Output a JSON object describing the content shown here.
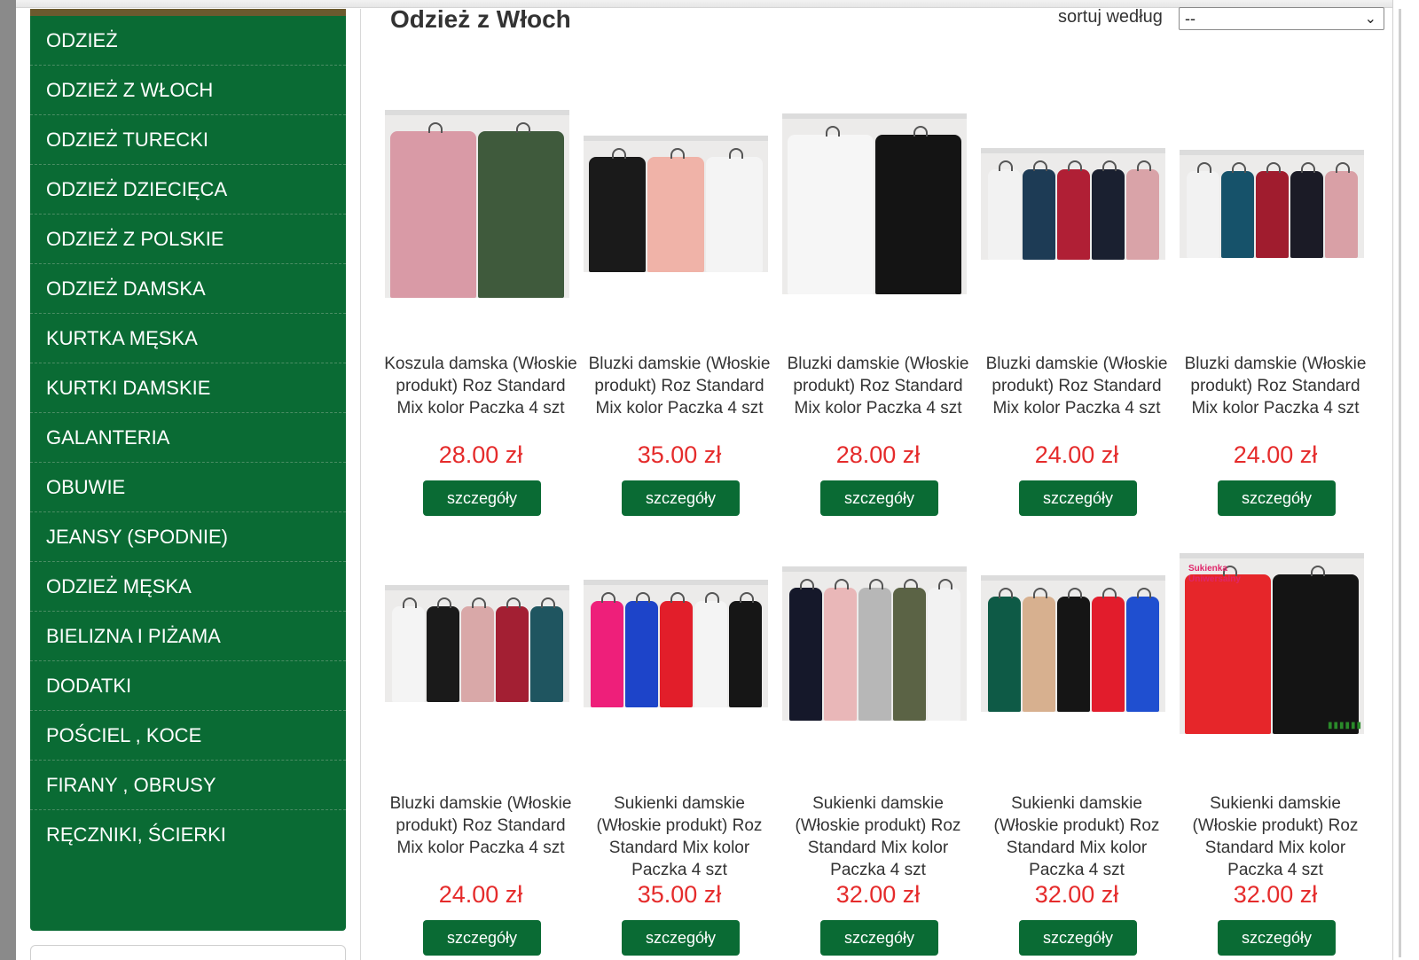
{
  "sidebar": {
    "items": [
      {
        "label": "ODZIEŻ"
      },
      {
        "label": "ODZIEŻ Z WŁOCH"
      },
      {
        "label": "ODZIEŻ TURECKI"
      },
      {
        "label": "ODZIEŻ DZIECIĘCA"
      },
      {
        "label": "ODZIEŻ Z POLSKIE"
      },
      {
        "label": "ODZIEŻ DAMSKA"
      },
      {
        "label": "KURTKA MĘSKA"
      },
      {
        "label": "KURTKI DAMSKIE"
      },
      {
        "label": "GALANTERIA"
      },
      {
        "label": "OBUWIE"
      },
      {
        "label": "JEANSY (SPODNIE)"
      },
      {
        "label": "ODZIEŻ MĘSKA"
      },
      {
        "label": "BIELIZNA I PIŻAMA"
      },
      {
        "label": "DODATKI"
      },
      {
        "label": "POŚCIEL , KOCE"
      },
      {
        "label": "FIRANY , OBRUSY"
      },
      {
        "label": "RĘCZNIKI, ŚCIERKI"
      }
    ]
  },
  "main": {
    "title": "Odzież z Włoch",
    "sort_label": "sortuj według",
    "sort_value": "--"
  },
  "colors": {
    "brand_green": "#0a6b34",
    "price_red": "#e52b2b"
  },
  "products": [
    {
      "title": "Koszula damska (Włoskie produkt) Roz Standard Mix kolor Paczka 4 szt",
      "price": "28.00 zł",
      "button": "szczegóły",
      "garments": [
        "#d99aa6",
        "#3f5a3c"
      ]
    },
    {
      "title": "Bluzki damskie (Włoskie produkt) Roz Standard Mix kolor Paczka 4 szt",
      "price": "35.00 zł",
      "button": "szczegóły",
      "garments": [
        "#1a1a1a",
        "#f0b3a8",
        "#f4f4f4"
      ]
    },
    {
      "title": "Bluzki damskie (Włoskie produkt) Roz Standard Mix kolor Paczka 4 szt",
      "price": "28.00 zł",
      "button": "szczegóły",
      "garments": [
        "#f6f6f6",
        "#141414"
      ]
    },
    {
      "title": "Bluzki damskie (Włoskie produkt) Roz Standard Mix kolor Paczka 4 szt",
      "price": "24.00 zł",
      "button": "szczegóły",
      "garments": [
        "#f2f2f2",
        "#1d3b55",
        "#b01f35",
        "#1a2030",
        "#d9a3a8"
      ]
    },
    {
      "title": "Bluzki damskie (Włoskie produkt) Roz Standard Mix kolor Paczka 4 szt",
      "price": "24.00 zł",
      "button": "szczegóły",
      "garments": [
        "#f2f2f2",
        "#16526a",
        "#a01c2e",
        "#1b1b26",
        "#d9a0a6"
      ]
    },
    {
      "title": "Bluzki damskie (Włoskie produkt) Roz Standard Mix kolor Paczka 4 szt",
      "price": "24.00 zł",
      "button": "szczegóły",
      "garments": [
        "#f4f4f4",
        "#1a1a1a",
        "#d9a8a8",
        "#a31f33",
        "#1f5560"
      ]
    },
    {
      "title": "Sukienki damskie (Włoskie produkt) Roz Standard Mix kolor Paczka 4 szt",
      "price": "35.00 zł",
      "button": "szczegóły",
      "garments": [
        "#ee1f7a",
        "#1d44c9",
        "#e21e2a",
        "#f4f4f4",
        "#161616"
      ]
    },
    {
      "title": "Sukienki damskie (Włoskie produkt) Roz Standard Mix kolor Paczka 4 szt",
      "price": "32.00 zł",
      "button": "szczegóły",
      "garments": [
        "#15182a",
        "#e9b7b8",
        "#b7b7b7",
        "#5b6345",
        "#f2f2f2"
      ]
    },
    {
      "title": "Sukienki damskie (Włoskie produkt) Roz Standard Mix kolor Paczka 4 szt",
      "price": "32.00 zł",
      "button": "szczegóły",
      "garments": [
        "#0e5a46",
        "#d7b08f",
        "#151515",
        "#e21c2c",
        "#1f4fd0"
      ]
    },
    {
      "title": "Sukienki damskie (Włoskie produkt) Roz Standard Mix kolor Paczka 4 szt",
      "price": "32.00 zł",
      "button": "szczegóły",
      "garments": [
        "#e6262a",
        "#141414"
      ],
      "badge": "Sukienka Uniwersalny"
    }
  ]
}
